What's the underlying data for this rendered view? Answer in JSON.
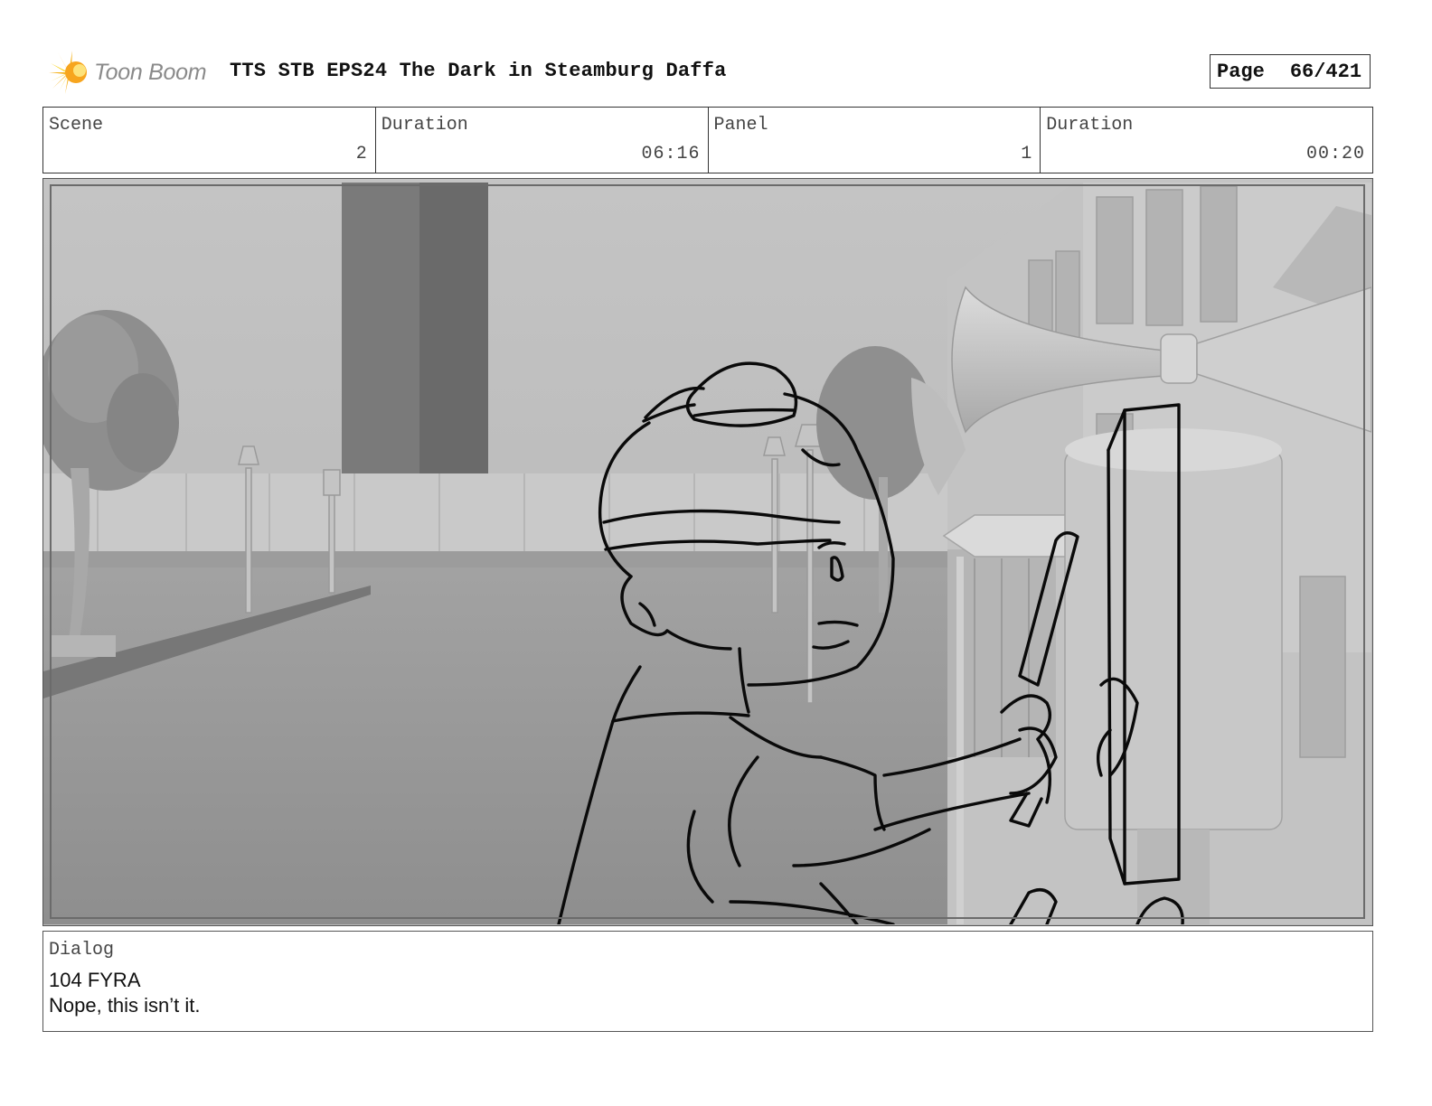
{
  "header": {
    "logo_text": "Toon Boom",
    "title": "TTS STB EPS24 The Dark in Steamburg Daffa",
    "page_label": "Page",
    "page_number": "66/421"
  },
  "info": {
    "scene_label": "Scene",
    "scene_value": "2",
    "duration_label": "Duration",
    "duration_value": "06:16",
    "panel_label": "Panel",
    "panel_value": "1",
    "panel_duration_label": "Duration",
    "panel_duration_value": "00:20"
  },
  "dialog": {
    "label": "Dialog",
    "line1": "104 FYRA",
    "line2": "Nope, this isn’t it."
  },
  "colors": {
    "logo_orange": "#f5a623",
    "logo_yellow": "#f8d21c",
    "border": "#333333",
    "sketch_line": "#0a0a0a"
  }
}
